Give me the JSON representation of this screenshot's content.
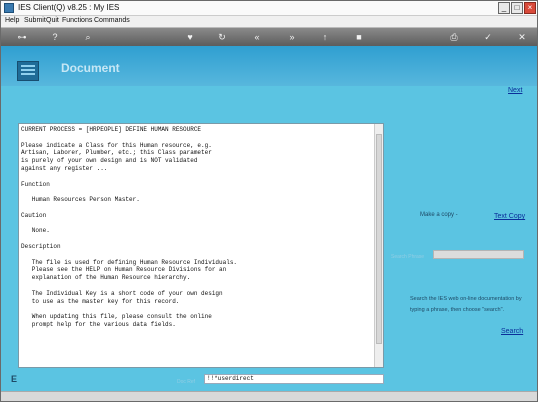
{
  "window": {
    "title": "IES Client(Q) v8.25 : My IES"
  },
  "menu": [
    "Help",
    "Submit",
    "Quit",
    "Functions",
    "Commands"
  ],
  "toolbar_icons": [
    "key-icon",
    "help-icon",
    "search-icon",
    "heart-icon",
    "refresh-icon",
    "back-icon",
    "forward-icon",
    "up-icon",
    "stop-icon",
    "print-icon",
    "check-icon",
    "close-icon"
  ],
  "header": {
    "title": "Document",
    "next": "Next"
  },
  "content": {
    "text": "CURRENT PROCESS = [HRPEOPLE] DEFINE HUMAN RESOURCE\n\nPlease indicate a Class for this Human resource, e.g.\nArtisan, Laborer, Plumber, etc.; this Class parameter\nis purely of your own design and is NOT validated\nagainst any register ...\n\nFunction\n\n   Human Resources Person Master.\n\nCaution\n\n   None.\n\nDescription\n\n   The file is used for defining Human Resource Individuals.\n   Please see the HELP on Human Resource Divisions for an\n   explanation of the Human Resource hierarchy.\n\n   The Individual Key is a short code of your own design\n   to use as the master key for this record.\n\n   When updating this file, please consult the online\n   prompt help for the various data fields."
  },
  "right_panel": {
    "copy_label": "Make a copy -",
    "text_copy": "Text Copy",
    "search_label": "Search Phrase",
    "search_value": "",
    "search_help": "Search the IES web on-line documentation by typing a phrase, then choose \"search\".",
    "search_link": "Search"
  },
  "bottom": {
    "side_icon": "E",
    "cmd_label": "Doc Ref",
    "cmd_value": "!!*userdirect"
  }
}
